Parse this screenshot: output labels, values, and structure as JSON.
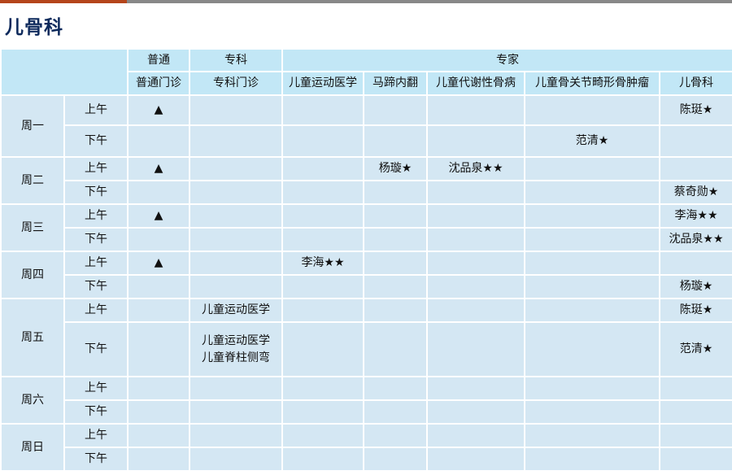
{
  "page": {
    "title": "儿骨科"
  },
  "colors": {
    "accent": "#b5451b",
    "top_bar": "#888888",
    "title": "#0e2a5c",
    "header_bg": "#c2e7f6",
    "cell_bg": "#d4e7f3"
  },
  "header": {
    "groups": [
      "普通",
      "专科",
      "专家"
    ],
    "columns": [
      "普通门诊",
      "专科门诊",
      "儿童运动医学",
      "马蹄内翻",
      "儿童代谢性骨病",
      "儿童骨关节畸形骨肿瘤",
      "儿骨科"
    ]
  },
  "schedule": [
    {
      "day": "周一",
      "slots": [
        {
          "period": "上午",
          "cells": [
            "▲",
            "",
            "",
            "",
            "",
            "",
            "陈珽★"
          ]
        },
        {
          "period": "下午",
          "cells": [
            "",
            "",
            "",
            "",
            "",
            "范清★",
            ""
          ]
        }
      ]
    },
    {
      "day": "周二",
      "slots": [
        {
          "period": "上午",
          "cells": [
            "▲",
            "",
            "",
            "杨璇★",
            "沈品泉★★",
            "",
            ""
          ]
        },
        {
          "period": "下午",
          "cells": [
            "",
            "",
            "",
            "",
            "",
            "",
            "蔡奇勋★"
          ]
        }
      ]
    },
    {
      "day": "周三",
      "slots": [
        {
          "period": "上午",
          "cells": [
            "▲",
            "",
            "",
            "",
            "",
            "",
            "李海★★"
          ]
        },
        {
          "period": "下午",
          "cells": [
            "",
            "",
            "",
            "",
            "",
            "",
            "沈品泉★★"
          ]
        }
      ]
    },
    {
      "day": "周四",
      "slots": [
        {
          "period": "上午",
          "cells": [
            "▲",
            "",
            "李海★★",
            "",
            "",
            "",
            ""
          ]
        },
        {
          "period": "下午",
          "cells": [
            "",
            "",
            "",
            "",
            "",
            "",
            "杨璇★"
          ]
        }
      ]
    },
    {
      "day": "周五",
      "slots": [
        {
          "period": "上午",
          "cells": [
            "",
            "儿童运动医学",
            "",
            "",
            "",
            "",
            "陈珽★"
          ]
        },
        {
          "period": "下午",
          "cells": [
            "",
            "儿童运动医学\n儿童脊柱侧弯",
            "",
            "",
            "",
            "",
            "范清★"
          ]
        }
      ]
    },
    {
      "day": "周六",
      "slots": [
        {
          "period": "上午",
          "cells": [
            "",
            "",
            "",
            "",
            "",
            "",
            ""
          ]
        },
        {
          "period": "下午",
          "cells": [
            "",
            "",
            "",
            "",
            "",
            "",
            ""
          ]
        }
      ]
    },
    {
      "day": "周日",
      "slots": [
        {
          "period": "上午",
          "cells": [
            "",
            "",
            "",
            "",
            "",
            "",
            ""
          ]
        },
        {
          "period": "下午",
          "cells": [
            "",
            "",
            "",
            "",
            "",
            "",
            ""
          ]
        }
      ]
    }
  ]
}
